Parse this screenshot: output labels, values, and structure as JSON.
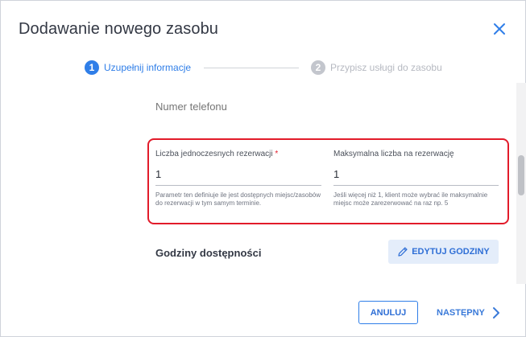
{
  "dialog": {
    "title": "Dodawanie nowego zasobu",
    "close_icon": "close-icon"
  },
  "stepper": {
    "steps": [
      {
        "number": "1",
        "label": "Uzupełnij informacje",
        "state": "active"
      },
      {
        "number": "2",
        "label": "Przypisz usługi do zasobu",
        "state": "inactive"
      }
    ]
  },
  "form": {
    "phone": {
      "placeholder": "Numer telefonu",
      "value": ""
    },
    "simultaneous": {
      "label": "Liczba jednoczesnych rezerwacji",
      "required_mark": "*",
      "value": "1",
      "hint": "Parametr ten definiuje ile jest dostępnych miejsc/zasobów do rezerwacji w tym samym terminie."
    },
    "max_per_booking": {
      "label": "Maksymalna liczba na rezerwację",
      "value": "1",
      "hint": "Jeśli więcej niż 1, klient może wybrać ile maksymalnie miejsc może zarezerwować na raz np. 5"
    }
  },
  "availability": {
    "title": "Godziny dostępności",
    "edit_label": "EDYTUJ GODZINY",
    "edit_icon": "pencil-icon"
  },
  "footer": {
    "cancel_label": "ANULUJ",
    "next_label": "NASTĘPNY",
    "next_icon": "chevron-right-icon"
  },
  "colors": {
    "accent": "#2f7ee8",
    "highlight": "#e21b2a",
    "step_inactive": "#c3c6cd"
  }
}
